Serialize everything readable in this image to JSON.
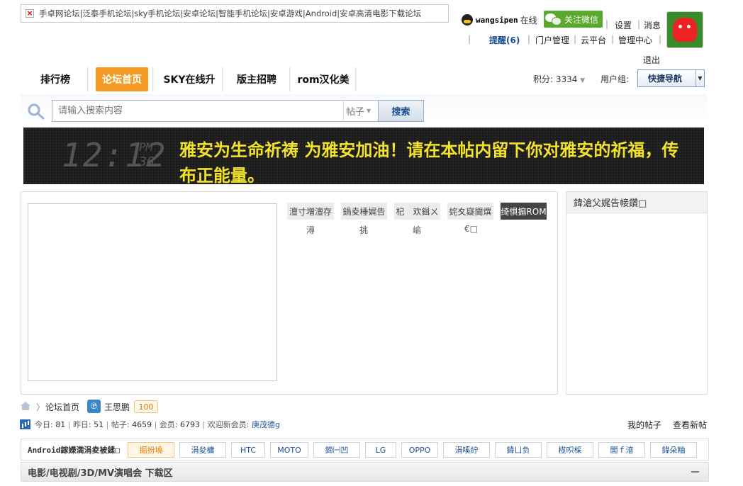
{
  "logo": {
    "broken_alt": "手卓网论坛|泛泰手机论坛|sky手机论坛|安卓论坛|智能手机论坛|安卓游戏|Android|安卓高清电影下载论坛"
  },
  "user": {
    "name": "wangsipen",
    "status": "在线",
    "wechat": "关注微信",
    "settings": "设置",
    "messages": "消息",
    "remind": "提醒(6)",
    "portal": "门户管理",
    "cloud": "云平台",
    "admin": "管理中心",
    "logout": "退出"
  },
  "nav": {
    "items": [
      "排行榜",
      "论坛首页",
      "SKY在线升",
      "版主招聘",
      "rom汉化美"
    ],
    "points_label": "积分:",
    "points_value": "3334",
    "group_label": "用户组:",
    "quick_nav": "快捷导航"
  },
  "search": {
    "placeholder": "请输入搜索内容",
    "type": "帖子",
    "button": "搜索"
  },
  "banner": {
    "clock": "12:12",
    "ampm": "PM",
    "seconds": "36",
    "text": "雅安为生命祈祷 为雅安加油！请在本帖内留下你对雅安的祈福，传布正能量。"
  },
  "tabs": [
    {
      "label": "澶寸増澶存",
      "sub": "潯"
    },
    {
      "label": "鍋夌棰娓告",
      "sub": "挑"
    },
    {
      "label": "杞　欢鍓ㄨ",
      "sub": "崳"
    },
    {
      "label": "姹夊寲閫熼",
      "sub": "€□"
    },
    {
      "label": "绮惧搧ROM",
      "sub": ""
    }
  ],
  "side": {
    "title": "鍏滄父娓告帹鑽□"
  },
  "breadcrumb": {
    "home": "论坛首页",
    "user": "王思鹏",
    "badge": "100"
  },
  "stats": {
    "today_label": "今日:",
    "today": "81",
    "yesterday_label": "昨日:",
    "yesterday": "51",
    "posts_label": "帖子:",
    "posts": "4659",
    "members_label": "会员:",
    "members": "6793",
    "welcome_label": "欢迎新会员:",
    "newest": "庚茂德g",
    "my_posts": "我的帖子",
    "new_posts": "查看新帖"
  },
  "brand": {
    "label": "Android鎵嬫満涓夌被鍒□",
    "tabs": [
      "掘扮墝",
      "涓夋槦",
      "HTC",
      "MOTO",
      "鍗㈠凹",
      "LG",
      "OPPO",
      "涓嗘紵",
      "鍏ㄩ负",
      "榄呮棌",
      "閭ｆ湆",
      "鍏朵粬"
    ]
  },
  "section": {
    "title": "电影/电视剧/3D/MV演唱会 下载区"
  }
}
